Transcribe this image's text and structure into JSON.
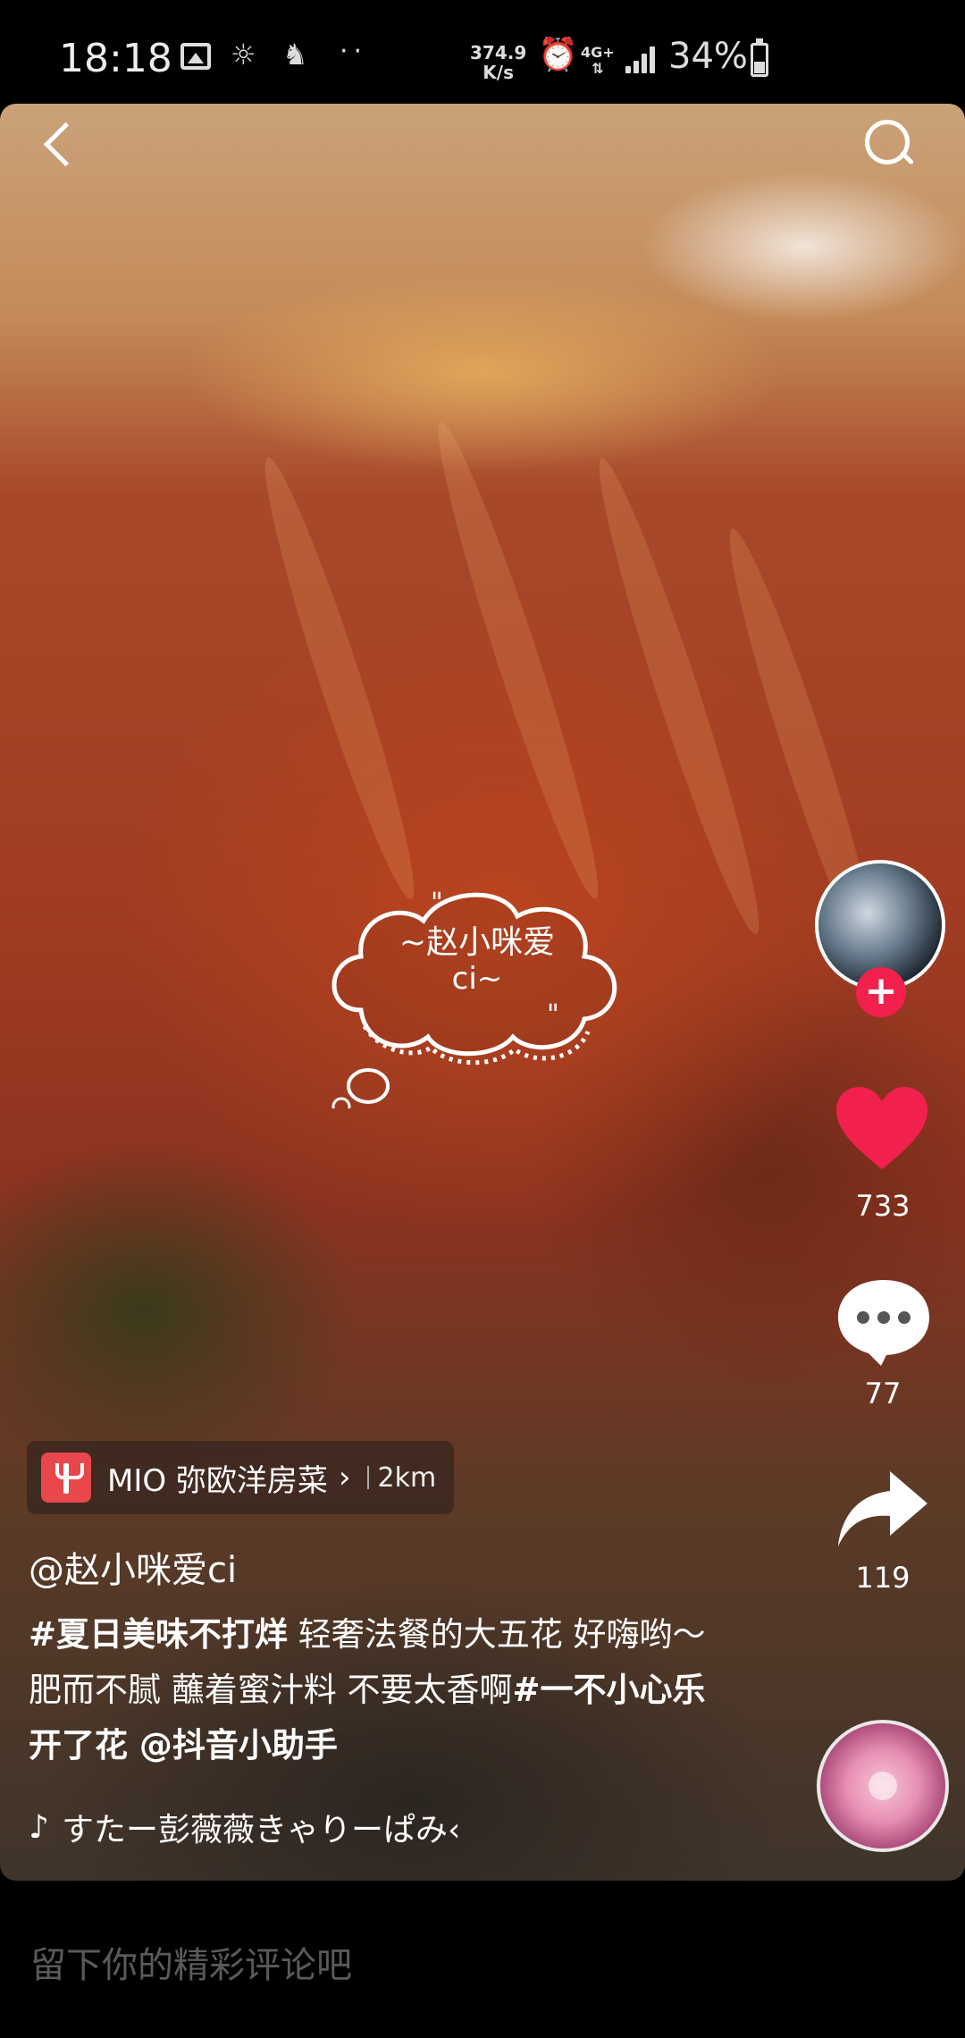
{
  "status_bar": {
    "time": "18:18",
    "net_speed_value": "374.9",
    "net_speed_unit": "K/s",
    "network_type": "4G+",
    "battery_percent": "34%",
    "icons": [
      "gallery-icon",
      "weather-icon",
      "app-notification-icon",
      "more-dots-icon",
      "alarm-icon",
      "signal-icon",
      "battery-icon"
    ]
  },
  "video": {
    "sticker_line1": "~赵小咪爱",
    "sticker_line2": "ci~"
  },
  "right_column": {
    "likes": "733",
    "comments": "77",
    "shares": "119",
    "like_color": "#f2204d"
  },
  "poi": {
    "name": "MIO 弥欧洋房菜",
    "distance": "2km"
  },
  "post": {
    "author": "@赵小咪爱ci",
    "caption_hashtag1": "#夏日美味不打烊",
    "caption_text1": " 轻奢法餐的大五花 好嗨哟～肥而不腻 蘸着蜜汁料 不要太香啊",
    "caption_hashtag2": "#一不小心乐开了花",
    "caption_mention": " @抖音小助手",
    "music": "すたー彭薇薇きゃりーぱみ‹"
  },
  "comment_bar": {
    "placeholder": "留下你的精彩评论吧"
  }
}
